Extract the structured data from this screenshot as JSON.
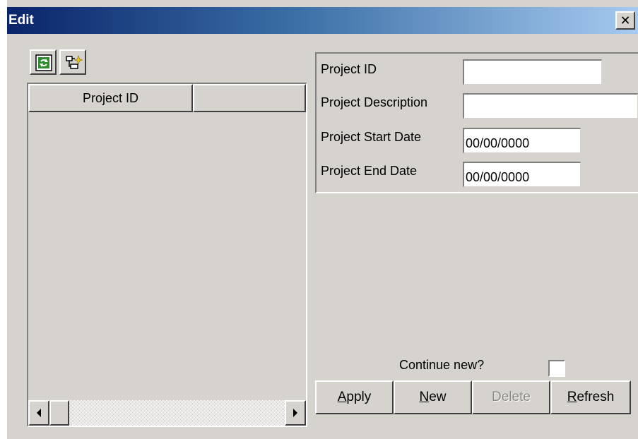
{
  "window": {
    "title": "Edit",
    "close_label": "✕"
  },
  "toolbar": {
    "refresh_icon": "refresh-icon",
    "tree_icon": "tree-structure-icon"
  },
  "list": {
    "columns": [
      "Project ID",
      ""
    ],
    "rows": []
  },
  "form": {
    "project_id": {
      "label": "Project ID",
      "value": ""
    },
    "project_description": {
      "label": "Project Description",
      "value": ""
    },
    "project_start_date": {
      "label": "Project Start Date",
      "value": "00/00/0000"
    },
    "project_end_date": {
      "label": "Project End Date",
      "value": "00/00/0000"
    }
  },
  "continue_new": {
    "label": "Continue new?",
    "checked": false
  },
  "buttons": {
    "apply": {
      "accel": "A",
      "rest": "pply"
    },
    "new": {
      "accel": "N",
      "rest": "ew"
    },
    "delete": {
      "label": "Delete",
      "enabled": false
    },
    "refresh": {
      "accel": "R",
      "rest": "efresh"
    }
  },
  "colors": {
    "face": "#d6d3ce",
    "title_start": "#0a246a",
    "title_end": "#a6caf0",
    "disabled_text": "#8c8a85"
  }
}
